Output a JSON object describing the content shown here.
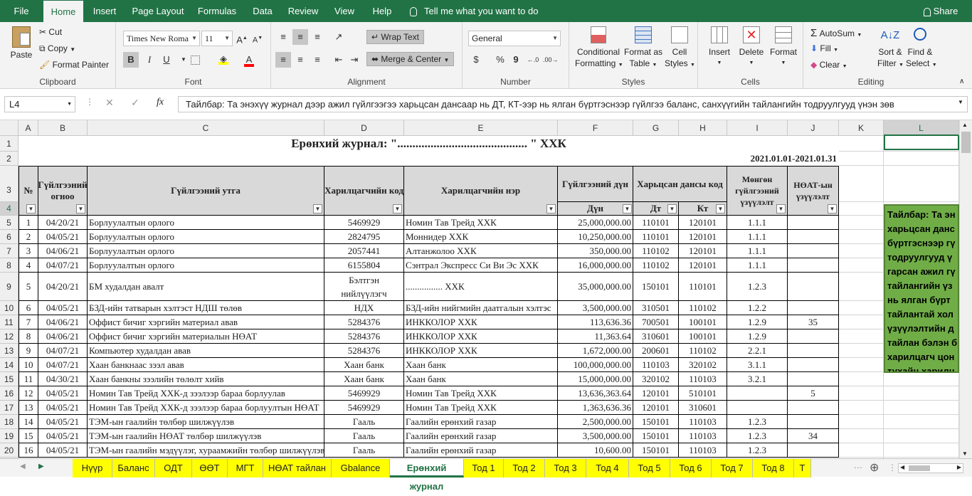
{
  "ribbon_tabs": [
    "File",
    "Home",
    "Insert",
    "Page Layout",
    "Formulas",
    "Data",
    "Review",
    "View",
    "Help"
  ],
  "tell_me": "Tell me what you want to do",
  "share": "Share",
  "clipboard": {
    "paste": "Paste",
    "cut": "Cut",
    "copy": "Copy",
    "format_painter": "Format Painter",
    "label": "Clipboard"
  },
  "font": {
    "name": "Times New Roma",
    "size": "11",
    "bold": "B",
    "italic": "I",
    "underline": "U",
    "label": "Font"
  },
  "alignment": {
    "wrap": "Wrap Text",
    "merge": "Merge & Center",
    "label": "Alignment"
  },
  "number": {
    "format": "General",
    "currency": "$",
    "percent": "%",
    "comma": "9",
    "label": "Number"
  },
  "styles": {
    "conditional": "Conditional",
    "conditional2": "Formatting",
    "format_as": "Format as",
    "format_as2": "Table",
    "cell_styles": "Cell",
    "cell_styles2": "Styles",
    "label": "Styles"
  },
  "cells": {
    "insert": "Insert",
    "delete": "Delete",
    "format": "Format",
    "label": "Cells"
  },
  "editing": {
    "autosum": "AutoSum",
    "fill": "Fill",
    "clear": "Clear",
    "sort": "Sort &",
    "sort2": "Filter",
    "find": "Find &",
    "find2": "Select",
    "label": "Editing"
  },
  "name_box": "L4",
  "formula": "Тайлбар: Та энэхүү журнал дээр ажил гүйлгээгээ харьцсан дансаар нь ДТ, КТ-ээр нь ялган бүртгэснээр гүйлгээ баланс, санхүүгийн тайлангийн тодруулгууд үнэн зөв",
  "columns": [
    "A",
    "B",
    "C",
    "D",
    "E",
    "F",
    "G",
    "H",
    "I",
    "J",
    "K",
    "L"
  ],
  "title": "Ерөнхий журнал: \"........................................... \" ХХК",
  "period": "2021.01.01-2021.01.31",
  "headers": {
    "no": "№",
    "date": "Гүйлгээний огноо",
    "desc": "Гүйлгээний утга",
    "code": "Харилцагчийн код",
    "partner": "Харилцагчийн нэр",
    "amount": "Гүйлгээний дүн",
    "amount_sub": "Дүн",
    "acct": "Харьцсан дансы код",
    "dt": "Дт",
    "kt": "Кт",
    "cash": "Мөнгөн гүйлгээний үзүүлэлт",
    "vat": "НӨАТ-ын үзүүлэлт"
  },
  "rows": [
    {
      "r": "5",
      "n": "1",
      "d": "04/20/21",
      "t": "Борлуулалтын орлого",
      "c": "5469929",
      "p": "Номин Тав Трейд ХХК",
      "a": "25,000,000.00",
      "dt": "110101",
      "kt": "120101",
      "cf": "1.1.1",
      "v": ""
    },
    {
      "r": "6",
      "n": "2",
      "d": "04/05/21",
      "t": "Борлуулалтын орлого",
      "c": "2824795",
      "p": "Моннидер ХХК",
      "a": "10,250,000.00",
      "dt": "110101",
      "kt": "120101",
      "cf": "1.1.1",
      "v": ""
    },
    {
      "r": "7",
      "n": "3",
      "d": "04/06/21",
      "t": "Борлуулалтын орлого",
      "c": "2057441",
      "p": "Алтанжолоо ХХК",
      "a": "350,000.00",
      "dt": "110102",
      "kt": "120101",
      "cf": "1.1.1",
      "v": ""
    },
    {
      "r": "8",
      "n": "4",
      "d": "04/07/21",
      "t": "Борлуулалтын орлого",
      "c": "6155804",
      "p": "Сэнтрал Экспресс Си Ви Эс ХХК",
      "a": "16,000,000.00",
      "dt": "110102",
      "kt": "120101",
      "cf": "1.1.1",
      "v": ""
    },
    {
      "r": "9",
      "n": "5",
      "d": "04/20/21",
      "t": "БМ худалдан авалт",
      "c": "Бэлтгэн нийлүүлэгч",
      "p": "................ ХХК",
      "a": "35,000,000.00",
      "dt": "150101",
      "kt": "110101",
      "cf": "1.2.3",
      "v": ""
    },
    {
      "r": "10",
      "n": "6",
      "d": "04/05/21",
      "t": "БЗД-ийн татварын хэлтэст НДШ төлөв",
      "c": "НДХ",
      "p": "БЗД-ийн нийгмийн даатгалын хэлтэс",
      "a": "3,500,000.00",
      "dt": "310501",
      "kt": "110102",
      "cf": "1.2.2",
      "v": ""
    },
    {
      "r": "11",
      "n": "7",
      "d": "04/06/21",
      "t": "Оффист бичиг хэргийн материал авав",
      "c": "5284376",
      "p": " ИНККОЛОР ХХК",
      "a": "113,636.36",
      "dt": "700501",
      "kt": "100101",
      "cf": "1.2.9",
      "v": "35"
    },
    {
      "r": "12",
      "n": "8",
      "d": "04/06/21",
      "t": "Оффист бичиг хэргийн материалын НӨАТ",
      "c": "5284376",
      "p": " ИНККОЛОР ХХК",
      "a": "11,363.64",
      "dt": "310601",
      "kt": "100101",
      "cf": "1.2.9",
      "v": ""
    },
    {
      "r": "13",
      "n": "9",
      "d": "04/07/21",
      "t": "Компьютер худалдан авав",
      "c": "5284376",
      "p": " ИНККОЛОР ХХК",
      "a": "1,672,000.00",
      "dt": "200601",
      "kt": "110102",
      "cf": "2.2.1",
      "v": ""
    },
    {
      "r": "14",
      "n": "10",
      "d": "04/07/21",
      "t": "Хаан банкнаас зээл авав",
      "c": "Хаан банк",
      "p": "Хаан банк",
      "a": "100,000,000.00",
      "dt": "110103",
      "kt": "320102",
      "cf": "3.1.1",
      "v": ""
    },
    {
      "r": "15",
      "n": "11",
      "d": "04/30/21",
      "t": "Хаан банкны зээлийн төлөлт хийв",
      "c": "Хаан банк",
      "p": "Хаан банк",
      "a": "15,000,000.00",
      "dt": "320102",
      "kt": "110103",
      "cf": "3.2.1",
      "v": ""
    },
    {
      "r": "16",
      "n": "12",
      "d": "04/05/21",
      "t": "Номин Тав Трейд ХХК-д зээлээр бараа борлуулав",
      "c": "5469929",
      "p": "Номин Тав Трейд ХХК",
      "a": "13,636,363.64",
      "dt": "120101",
      "kt": "510101",
      "cf": "",
      "v": "5"
    },
    {
      "r": "17",
      "n": "13",
      "d": "04/05/21",
      "t": "Номин Тав Трейд ХХК-д зээлээр бараа борлуултын НӨАТ",
      "c": "5469929",
      "p": "Номин Тав Трейд ХХК",
      "a": "1,363,636.36",
      "dt": "120101",
      "kt": "310601",
      "cf": "",
      "v": ""
    },
    {
      "r": "18",
      "n": "14",
      "d": "04/05/21",
      "t": "ТЭМ-ын гаалийн төлбөр шилжүүлэв",
      "c": "Гааль",
      "p": "Гаалийн ерөнхий газар",
      "a": "2,500,000.00",
      "dt": "150101",
      "kt": "110103",
      "cf": "1.2.3",
      "v": ""
    },
    {
      "r": "19",
      "n": "15",
      "d": "04/05/21",
      "t": "ТЭМ-ын гаалийн НӨАТ төлбөр шилжүүлэв",
      "c": "Гааль",
      "p": "Гаалийн ерөнхий газар",
      "a": "3,500,000.00",
      "dt": "150101",
      "kt": "110103",
      "cf": "1.2.3",
      "v": "34"
    },
    {
      "r": "20",
      "n": "16",
      "d": "04/05/21",
      "t": "ТЭМ-ын гаалийн мэдүүлэг, хураамжийн төлбөр шилжүүлэв",
      "c": "Гааль",
      "p": "Гаалийн ерөнхий газар",
      "a": "10,600.00",
      "dt": "150101",
      "kt": "110103",
      "cf": "1.2.3",
      "v": ""
    }
  ],
  "note_lines": [
    "Тайлбар: Та эн",
    "харьцсан данс",
    "бүртгэснээр гү",
    "тодруулгууд ү",
    "гарсан ажил гү",
    "тайлангийн үз",
    "нь ялган бүрт",
    "тайлантай хол",
    "үзүүлэлтийн д",
    "тайлан бэлэн б",
    "харилцагч цон",
    "тухайн харилц"
  ],
  "sheets": [
    "Нүүр",
    "Баланс",
    "ОДТ",
    "ӨӨТ",
    "МГТ",
    "НӨАТ тайлан",
    "Gbalance",
    "Ерөнхий журнал",
    "Тод 1",
    "Тод 2",
    "Тод 3",
    "Тод 4",
    "Тод 5",
    "Тод 6",
    "Тод 7",
    "Тод 8",
    "Т"
  ],
  "active_sheet": "Ерөнхий журнал"
}
